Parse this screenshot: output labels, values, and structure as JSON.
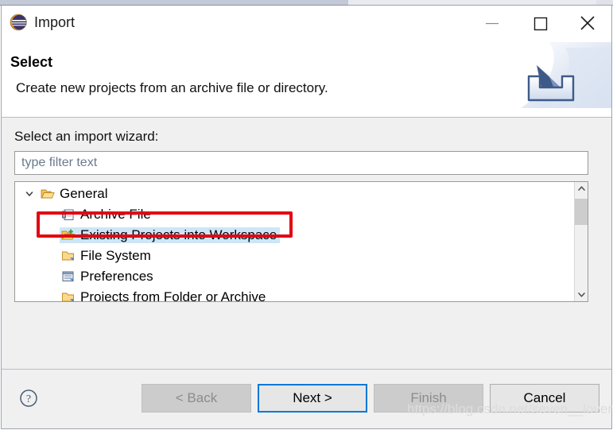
{
  "window": {
    "title": "Import",
    "app_icon": "eclipse-logo-icon",
    "controls": {
      "minimize": "minimize-icon",
      "maximize": "maximize-icon",
      "close": "close-icon"
    }
  },
  "header": {
    "title": "Select",
    "description": "Create new projects from an archive file or directory.",
    "banner_icon": "import-arrow-into-tray-icon"
  },
  "body": {
    "label": "Select an import wizard:",
    "filter": {
      "value": "",
      "placeholder": "type filter text"
    },
    "tree": [
      {
        "label": "General",
        "level": 0,
        "icon": "open-folder-icon",
        "twisty": "chevron-down-icon",
        "expanded": true,
        "selected": false
      },
      {
        "label": "Archive File",
        "level": 1,
        "icon": "archive-file-icon",
        "selected": false
      },
      {
        "label": "Existing Projects into Workspace",
        "level": 1,
        "icon": "folder-import-icon",
        "selected": true
      },
      {
        "label": "File System",
        "level": 1,
        "icon": "folder-icon",
        "selected": false
      },
      {
        "label": "Preferences",
        "level": 1,
        "icon": "preferences-icon",
        "selected": false
      },
      {
        "label": "Projects from Folder or Archive",
        "level": 1,
        "icon": "folder-icon",
        "selected": false
      }
    ],
    "scrollbar": {
      "up_icon": "chevron-up-icon",
      "down_icon": "chevron-down-icon"
    },
    "annotation": {
      "color": "#e30613",
      "target": "Existing Projects into Workspace"
    }
  },
  "footer": {
    "help_icon": "help-question-icon",
    "buttons": [
      {
        "label": "< Back",
        "state": "disabled"
      },
      {
        "label": "Next >",
        "state": "default"
      },
      {
        "label": "Finish",
        "state": "disabled"
      },
      {
        "label": "Cancel",
        "state": "normal"
      }
    ]
  },
  "watermark": "https://blog.csdn.net/seven__lover",
  "colors": {
    "selection": "#cde6f7",
    "annotation": "#e30613",
    "focus_border": "#0078d7",
    "body_bg": "#f0f0f0"
  }
}
